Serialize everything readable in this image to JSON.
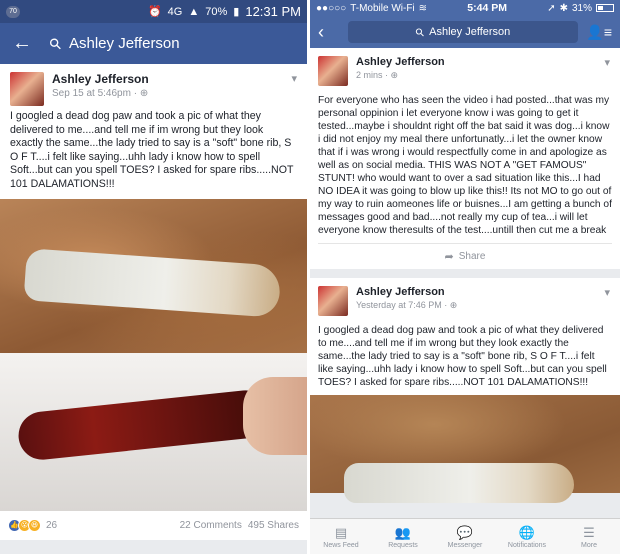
{
  "left": {
    "status": {
      "notification": "70",
      "signal": "4G",
      "battery": "70%",
      "time": "12:31 PM"
    },
    "nav": {
      "search_query": "Ashley Jefferson"
    },
    "post": {
      "author": "Ashley Jefferson",
      "timestamp": "Sep 15 at 5:46pm · ",
      "text": "I googled a dead dog paw and took a pic of what they delivered to me....and tell me if im wrong but they look exactly the same...the lady tried to say is a \"soft\" bone rib, S O F T....i felt like saying...uhh lady i know how to spell Soft...but can you spell TOES? I asked for spare ribs.....NOT 101 DALAMATIONS!!!",
      "reaction_count": "26",
      "comments": "22 Comments",
      "shares": "495 Shares"
    }
  },
  "right": {
    "status": {
      "carrier": "T-Mobile Wi-Fi",
      "time": "5:44 PM",
      "battery": "31%"
    },
    "nav": {
      "search_query": "Ashley Jefferson"
    },
    "post1": {
      "author": "Ashley Jefferson",
      "timestamp": "2 mins · ",
      "text": "For everyone who has seen the video i had posted...that was my personal oppinion i let everyone know i was going to get it tested...maybe i shouldnt right off the bat said it was dog...i know i did not enjoy my meal there unfortunatly...i let the owner know that if i was wrong i would respectfully come in and apologize as well as on social media. THIS WAS NOT A \"GET FAMOUS\" STUNT! who would want to over a sad situation like this...I had NO IDEA it was going to blow up like this!! Its not MO to go out of my way to ruin aomeones life or buisnes...I am getting a bunch of messages good and bad....not really my cup of tea...i will let everyone know theresults of the test....untill then cut me a break",
      "share_label": "Share"
    },
    "post2": {
      "author": "Ashley Jefferson",
      "timestamp": "Yesterday at 7:46 PM · ",
      "text": "I googled a dead dog paw and took a pic of what they delivered to me....and tell me if im wrong but they look exactly the same...the lady tried to say is a \"soft\" bone rib, S O F T....i felt like saying...uhh lady i know how to spell Soft...but can you spell TOES? I asked for spare ribs.....NOT 101 DALAMATIONS!!!"
    },
    "tabs": [
      {
        "label": "News Feed",
        "icon": "news-feed-icon"
      },
      {
        "label": "Requests",
        "icon": "friend-requests-icon"
      },
      {
        "label": "Messenger",
        "icon": "messenger-icon"
      },
      {
        "label": "Notifications",
        "icon": "globe-icon"
      },
      {
        "label": "More",
        "icon": "menu-icon"
      }
    ]
  },
  "colors": {
    "android_nav": "#3b5998",
    "ios_nav": "#4b6aa7",
    "link_gray": "#90949c"
  }
}
